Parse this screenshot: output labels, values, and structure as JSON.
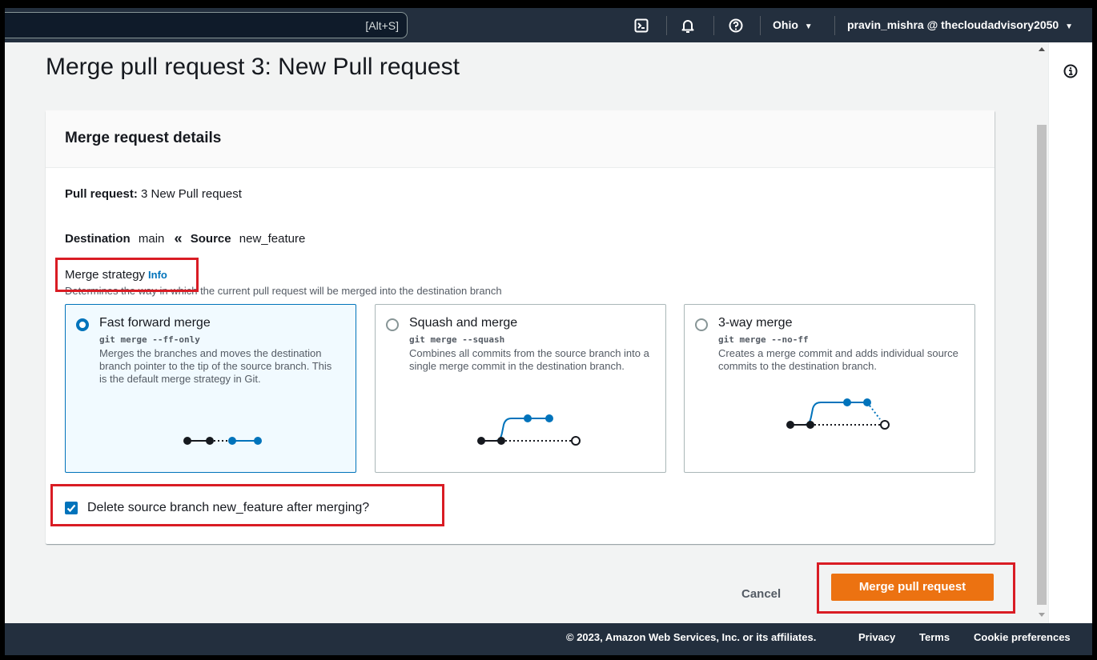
{
  "topnav": {
    "search_shortcut": "[Alt+S]",
    "region": "Ohio",
    "account": "pravin_mishra @ thecloudadvisory2050"
  },
  "page": {
    "title": "Merge pull request 3: New Pull request"
  },
  "panel": {
    "header": "Merge request details",
    "pull_request_label": "Pull request:",
    "pull_request_value": "3 New Pull request",
    "destination_label": "Destination",
    "destination_value": "main",
    "source_label": "Source",
    "source_value": "new_feature",
    "strategy_label": "Merge strategy",
    "strategy_info": "Info",
    "strategy_desc": "Determines the way in which the current pull request will be merged into the destination branch"
  },
  "strategies": [
    {
      "title": "Fast forward merge",
      "command": "git merge --ff-only",
      "description": "Merges the branches and moves the destination branch pointer to the tip of the source branch. This is the default merge strategy in Git.",
      "selected": true
    },
    {
      "title": "Squash and merge",
      "command": "git merge --squash",
      "description": "Combines all commits from the source branch into a single merge commit in the destination branch.",
      "selected": false
    },
    {
      "title": "3-way merge",
      "command": "git merge --no-ff",
      "description": "Creates a merge commit and adds individual source commits to the destination branch.",
      "selected": false
    }
  ],
  "delete_branch": {
    "label": "Delete source branch new_feature after merging?",
    "checked": true
  },
  "actions": {
    "cancel": "Cancel",
    "merge": "Merge pull request"
  },
  "footer": {
    "copyright": "© 2023, Amazon Web Services, Inc. or its affiliates.",
    "privacy": "Privacy",
    "terms": "Terms",
    "cookies": "Cookie preferences"
  },
  "colors": {
    "accent": "#0073bb",
    "primary_button": "#ec7211",
    "highlight": "#d91c24",
    "nav_bg": "#232f3e"
  },
  "icons": [
    "cloudshell-icon",
    "bell-icon",
    "help-icon",
    "caret-down-icon",
    "info-circle-icon",
    "checkmark-icon"
  ]
}
